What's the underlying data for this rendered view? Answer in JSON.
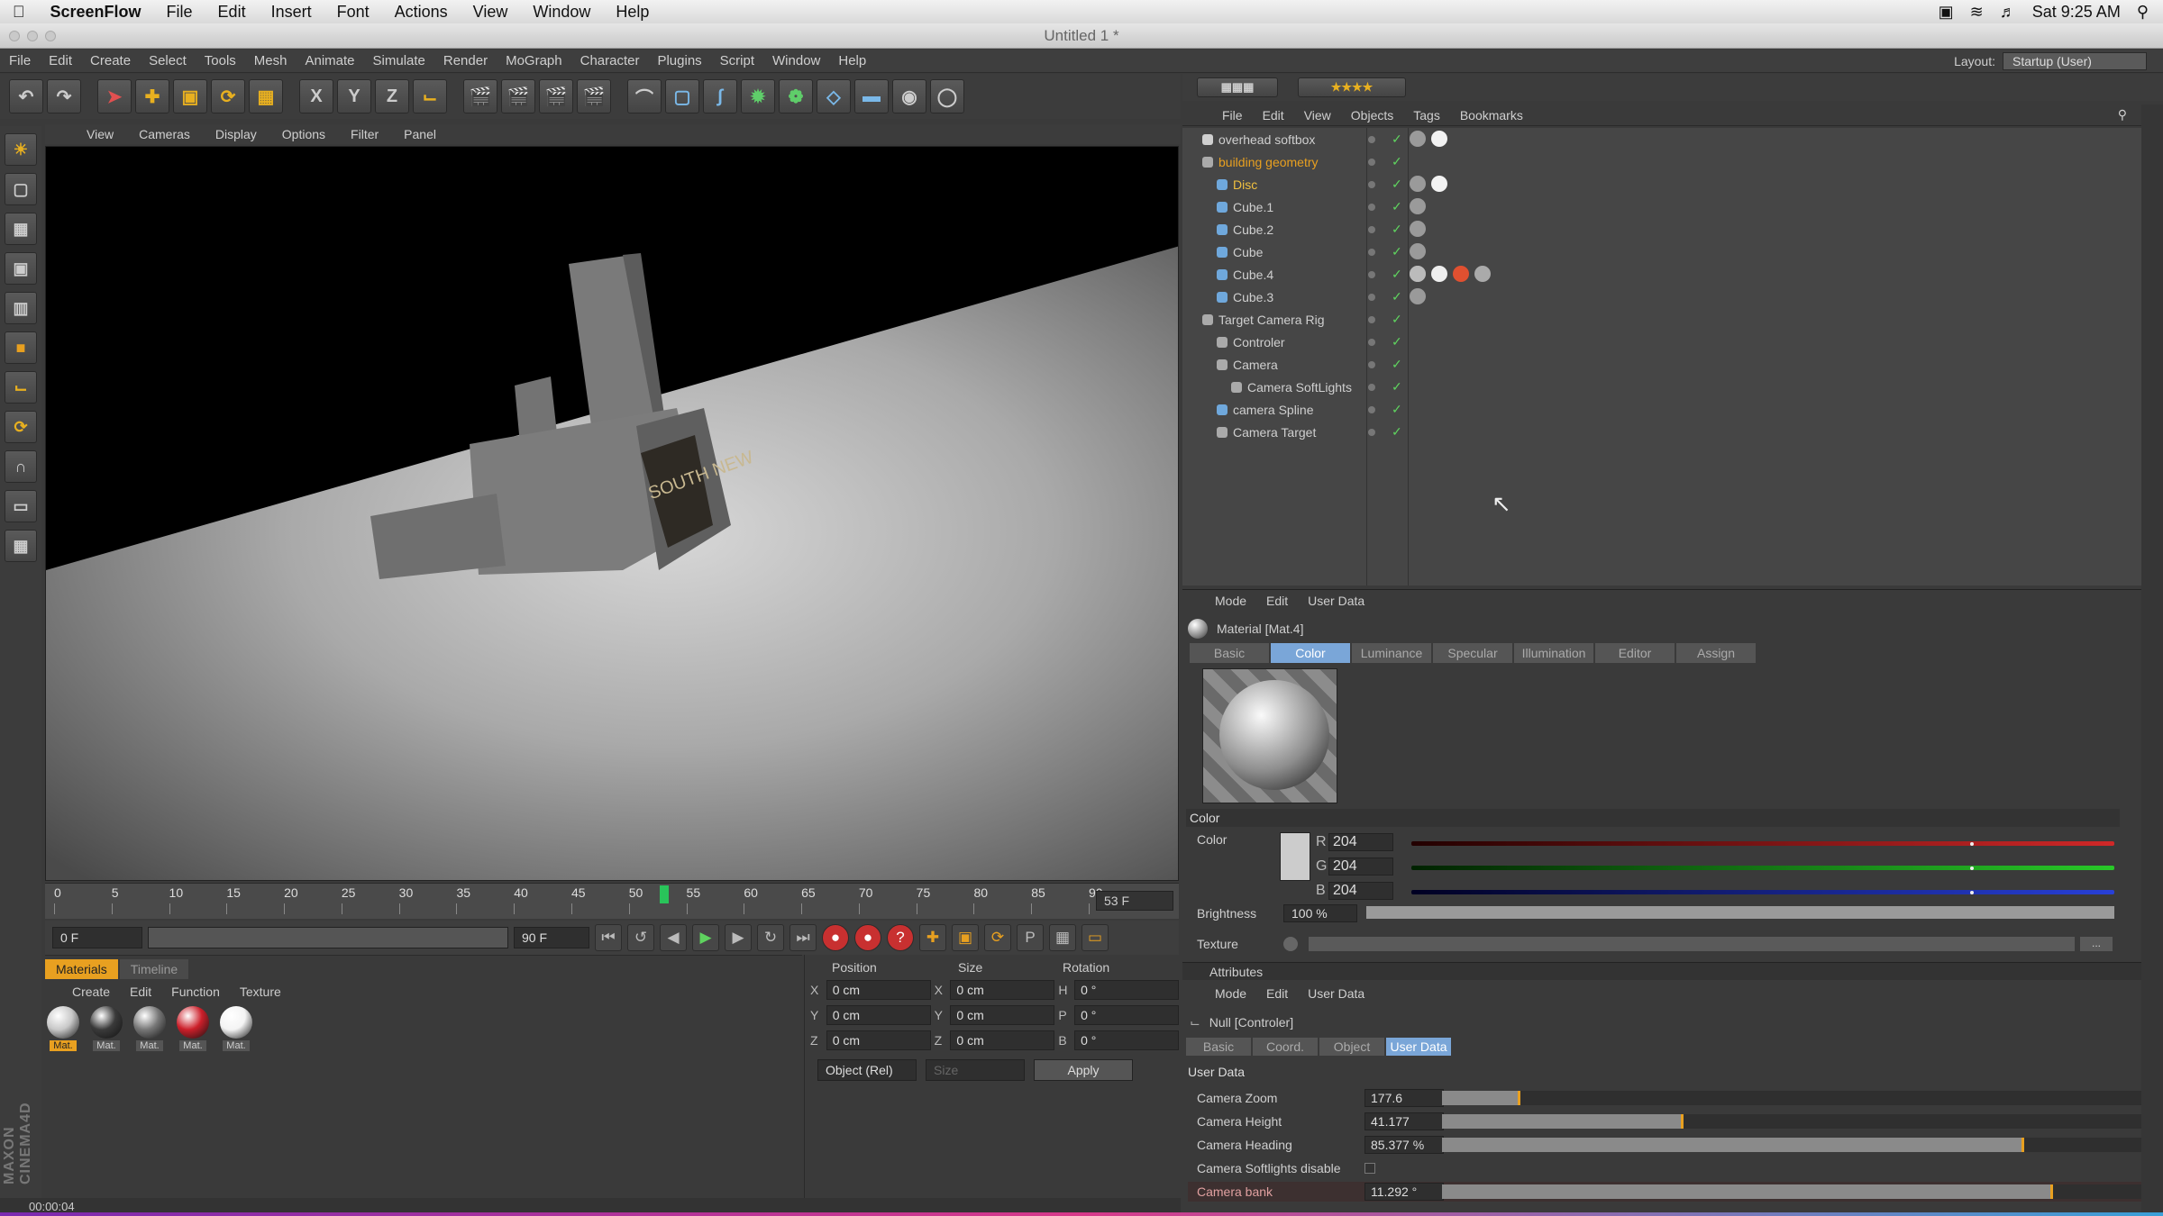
{
  "macbar": {
    "app": "ScreenFlow",
    "menus": [
      "File",
      "Edit",
      "Insert",
      "Font",
      "Actions",
      "View",
      "Window",
      "Help"
    ],
    "clock": "Sat 9:25 AM"
  },
  "window": {
    "title": "Untitled 1 *"
  },
  "c4dmenu": {
    "items": [
      "File",
      "Edit",
      "Create",
      "Select",
      "Tools",
      "Mesh",
      "Animate",
      "Simulate",
      "Render",
      "MoGraph",
      "Character",
      "Plugins",
      "Script",
      "Window",
      "Help"
    ],
    "layout_label": "Layout:",
    "layout_value": "Startup (User)"
  },
  "toolbar": {
    "x": "X",
    "y": "Y",
    "z": "Z"
  },
  "viewport": {
    "menu": [
      "View",
      "Cameras",
      "Display",
      "Options",
      "Filter",
      "Panel"
    ],
    "sign_text": "SOUTH NEW"
  },
  "timeline": {
    "ticks": [
      "0",
      "5",
      "10",
      "15",
      "20",
      "25",
      "30",
      "35",
      "40",
      "45",
      "50",
      "55",
      "60",
      "65",
      "70",
      "75",
      "80",
      "85",
      "90"
    ],
    "current_frame_label": "53",
    "end_frame": "53 F",
    "playhead_frame": 53,
    "max_frame": 90
  },
  "transport": {
    "start": "0 F",
    "range_start": "0 F",
    "range_end": "90 F",
    "end": "90 F"
  },
  "materials": {
    "tabs": [
      "Materials",
      "Timeline"
    ],
    "menu": [
      "Create",
      "Edit",
      "Function",
      "Texture"
    ],
    "swatches": [
      {
        "label": "Mat.",
        "color": "#c8c8c8"
      },
      {
        "label": "Mat.",
        "color": "#3a3a3a"
      },
      {
        "label": "Mat.",
        "color": "#777777"
      },
      {
        "label": "Mat.",
        "color": "#cc1f2a"
      },
      {
        "label": "Mat.",
        "color": "#f4f4f4"
      }
    ]
  },
  "coords": {
    "headers": [
      "Position",
      "Size",
      "Rotation"
    ],
    "rows": [
      {
        "axis": "X",
        "pos": "0 cm",
        "size_axis": "X",
        "size": "0 cm",
        "rot_axis": "H",
        "rot": "0 °"
      },
      {
        "axis": "Y",
        "pos": "0 cm",
        "size_axis": "Y",
        "size": "0 cm",
        "rot_axis": "P",
        "rot": "0 °"
      },
      {
        "axis": "Z",
        "pos": "0 cm",
        "size_axis": "Z",
        "size": "0 cm",
        "rot_axis": "B",
        "rot": "0 °"
      }
    ],
    "mode": "Object (Rel)",
    "size_mode": "Size",
    "apply": "Apply"
  },
  "status": {
    "time": "00:00:04"
  },
  "objects": {
    "menu": [
      "File",
      "Edit",
      "View",
      "Objects",
      "Tags",
      "Bookmarks"
    ],
    "items": [
      {
        "name": "overhead softbox",
        "indent": 0,
        "color": "#cfcfcf"
      },
      {
        "name": "building geometry",
        "indent": 0,
        "color": "#e8a020"
      },
      {
        "name": "Disc",
        "indent": 1,
        "color": "#f0c040"
      },
      {
        "name": "Cube.1",
        "indent": 1,
        "color": "#cfcfcf"
      },
      {
        "name": "Cube.2",
        "indent": 1,
        "color": "#cfcfcf"
      },
      {
        "name": "Cube",
        "indent": 1,
        "color": "#cfcfcf"
      },
      {
        "name": "Cube.4",
        "indent": 1,
        "color": "#cfcfcf"
      },
      {
        "name": "Cube.3",
        "indent": 1,
        "color": "#cfcfcf"
      },
      {
        "name": "Target Camera Rig",
        "indent": 0,
        "color": "#cfcfcf"
      },
      {
        "name": "Controler",
        "indent": 1,
        "color": "#cfcfcf"
      },
      {
        "name": "Camera",
        "indent": 1,
        "color": "#cfcfcf"
      },
      {
        "name": "Camera SoftLights",
        "indent": 2,
        "color": "#cfcfcf"
      },
      {
        "name": "camera Spline",
        "indent": 1,
        "color": "#cfcfcf"
      },
      {
        "name": "Camera Target",
        "indent": 1,
        "color": "#cfcfcf"
      }
    ]
  },
  "material_editor": {
    "menu": [
      "Mode",
      "Edit",
      "User Data"
    ],
    "name": "Material [Mat.4]",
    "tabs": [
      "Basic",
      "Color",
      "Luminance",
      "Specular",
      "Illumination",
      "Editor",
      "Assign"
    ],
    "active_tab": "Color",
    "section": "Color",
    "color_label": "Color",
    "r_label": "R",
    "r": "204",
    "g_label": "G",
    "g": "204",
    "b_label": "B",
    "b": "204",
    "brightness_label": "Brightness",
    "brightness": "100 %",
    "texture_label": "Texture"
  },
  "attributes": {
    "title": "Attributes",
    "menu": [
      "Mode",
      "Edit",
      "User Data"
    ],
    "name": "Null [Controler]",
    "tabs": [
      "Basic",
      "Coord.",
      "Object",
      "User Data"
    ],
    "active_tab": "User Data",
    "section": "User Data",
    "fields": [
      {
        "label": "Camera Zoom",
        "value": "177.6",
        "fraction": 0.11
      },
      {
        "label": "Camera Height",
        "value": "41.177",
        "fraction": 0.34
      },
      {
        "label": "Camera Heading",
        "value": "85.377 %",
        "fraction": 0.82
      },
      {
        "label": "Camera Softlights disable",
        "value": "",
        "fraction": -1
      },
      {
        "label": "Camera bank",
        "value": "11.292 °",
        "fraction": 0.86
      }
    ]
  }
}
